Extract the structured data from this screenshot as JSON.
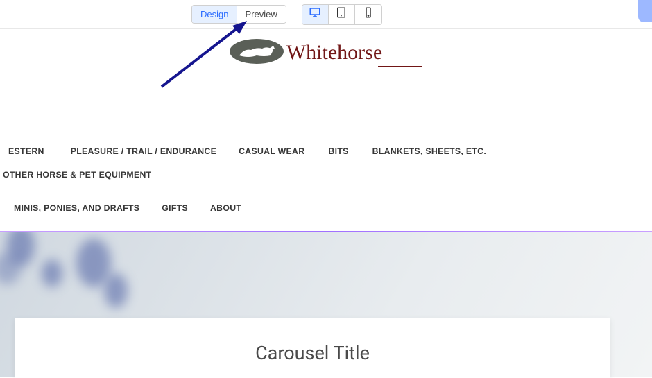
{
  "toolbar": {
    "design_label": "Design",
    "preview_label": "Preview",
    "active_mode": "design",
    "active_device": "desktop"
  },
  "logo": {
    "text": "Whitehorse"
  },
  "nav": {
    "row1": [
      "ESTERN",
      "PLEASURE / TRAIL / ENDURANCE",
      "CASUAL WEAR",
      "BITS",
      "BLANKETS, SHEETS, ETC.",
      "OTHER HORSE & PET EQUIPMENT"
    ],
    "row2": [
      "MINIS, PONIES, AND DRAFTS",
      "GIFTS",
      "ABOUT"
    ]
  },
  "carousel": {
    "title": "Carousel Title"
  }
}
